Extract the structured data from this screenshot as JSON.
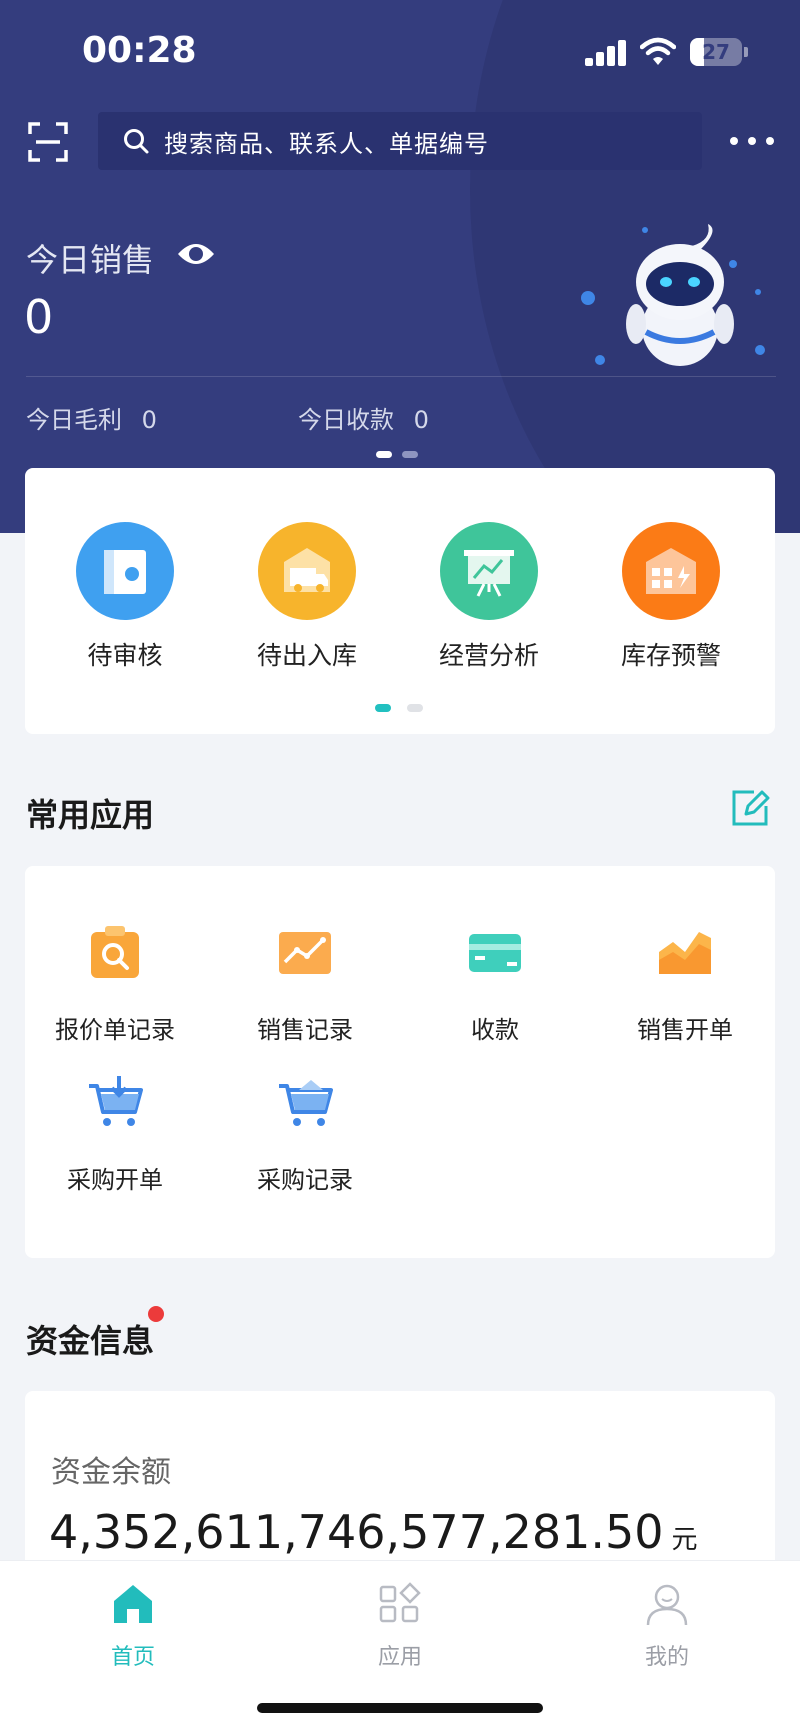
{
  "status_bar": {
    "time": "00:28",
    "battery": "27",
    "battery_level": 0.27
  },
  "search": {
    "placeholder": "搜索商品、联系人、单据编号"
  },
  "sales": {
    "title": "今日销售",
    "value": "0",
    "gross_profit_label": "今日毛利",
    "gross_profit_value": "0",
    "receipts_label": "今日收款",
    "receipts_value": "0"
  },
  "quick_actions": [
    {
      "label": "待审核",
      "icon": "book-icon",
      "color": "#3fa0f0"
    },
    {
      "label": "待出入库",
      "icon": "truck-icon",
      "color": "#f7b42c"
    },
    {
      "label": "经营分析",
      "icon": "presentation-chart-icon",
      "color": "#3fc59a"
    },
    {
      "label": "库存预警",
      "icon": "warehouse-icon",
      "color": "#fb7b16"
    }
  ],
  "common_apps": {
    "title": "常用应用",
    "items": [
      {
        "label": "报价单记录",
        "icon": "quote-search-icon"
      },
      {
        "label": "销售记录",
        "icon": "sales-chart-icon"
      },
      {
        "label": "收款",
        "icon": "card-icon"
      },
      {
        "label": "销售开单",
        "icon": "area-chart-icon"
      },
      {
        "label": "采购开单",
        "icon": "cart-download-icon"
      },
      {
        "label": "采购记录",
        "icon": "cart-icon"
      }
    ]
  },
  "funds": {
    "title": "资金信息",
    "balance_label": "资金余额",
    "balance_value": "4,352,611,746,577,281.50",
    "unit": "元"
  },
  "tabbar": [
    {
      "label": "首页",
      "active": true,
      "icon": "home-icon"
    },
    {
      "label": "应用",
      "active": false,
      "icon": "apps-grid-icon"
    },
    {
      "label": "我的",
      "active": false,
      "icon": "user-icon"
    }
  ],
  "colors": {
    "primary_dark": "#343d7e",
    "accent": "#22bcbc",
    "badge": "#ec3b3b"
  }
}
